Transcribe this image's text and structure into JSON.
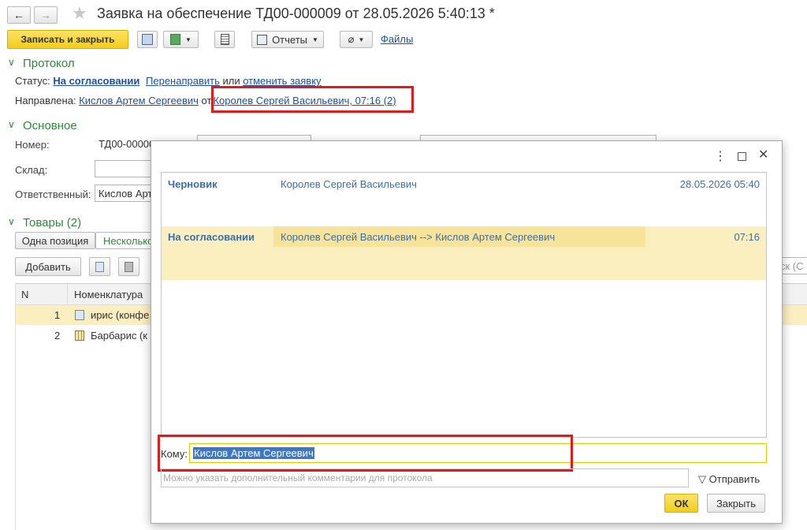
{
  "header": {
    "title": "Заявка на обеспечение ТД00-000009 от 28.05.2026 5:40:13 *",
    "back_icon": "arrow-left-icon",
    "forward_icon": "arrow-right-icon",
    "favorite_icon": "star-icon"
  },
  "toolbar": {
    "save_close": "Записать и закрыть",
    "reports": "Отчеты",
    "files": "Файлы"
  },
  "protocol": {
    "title": "Протокол",
    "status_label": "Статус:",
    "status_value": "На согласовании",
    "redirect": "Перенаправить",
    "or": "или",
    "cancel": "отменить заявку",
    "sent_label": "Направлена:",
    "sent_to": "Кислов Артем Сергеевич",
    "from_word": "от",
    "sent_from": "Королев Сергей Васильевич, 07:16 (2)"
  },
  "main": {
    "title": "Основное",
    "number_label": "Номер:",
    "number_value": "ТД00-00000",
    "warehouse_label": "Склад:",
    "responsible_label": "Ответственный:",
    "responsible_value": "Кислов Арт"
  },
  "goods": {
    "title": "Товары (2)",
    "tab_one": "Одна позиция",
    "tab_many": "Несколько",
    "add": "Добавить",
    "search_hint": "ск (С",
    "columns": [
      "N",
      "Номенклатура"
    ],
    "rows": [
      {
        "n": "1",
        "name": "ирис (конфе"
      },
      {
        "n": "2",
        "name": "Барбарис (к"
      }
    ]
  },
  "dialog": {
    "history": [
      {
        "status": "Черновик",
        "who": "Королев Сергей Васильевич",
        "when": "28.05.2026 05:40"
      },
      {
        "status": "На согласовании",
        "who": "Королев Сергей Васильевич --> Кислов Артем Сергеевич",
        "when": "07:16"
      }
    ],
    "to_label": "Кому:",
    "to_value": "Кислов Артем Сергеевич",
    "comment_placeholder": "Можно указать дополнительный комментарии для протокола",
    "send": "Отправить",
    "ok": "ОК",
    "close": "Закрыть"
  },
  "colors": {
    "accent_yellow": "#f5d21d",
    "highlight_row": "#fbefbf",
    "section_green": "#2c8a3a",
    "link_blue": "#1d4fa2",
    "annotation_red": "#e01b1b"
  }
}
